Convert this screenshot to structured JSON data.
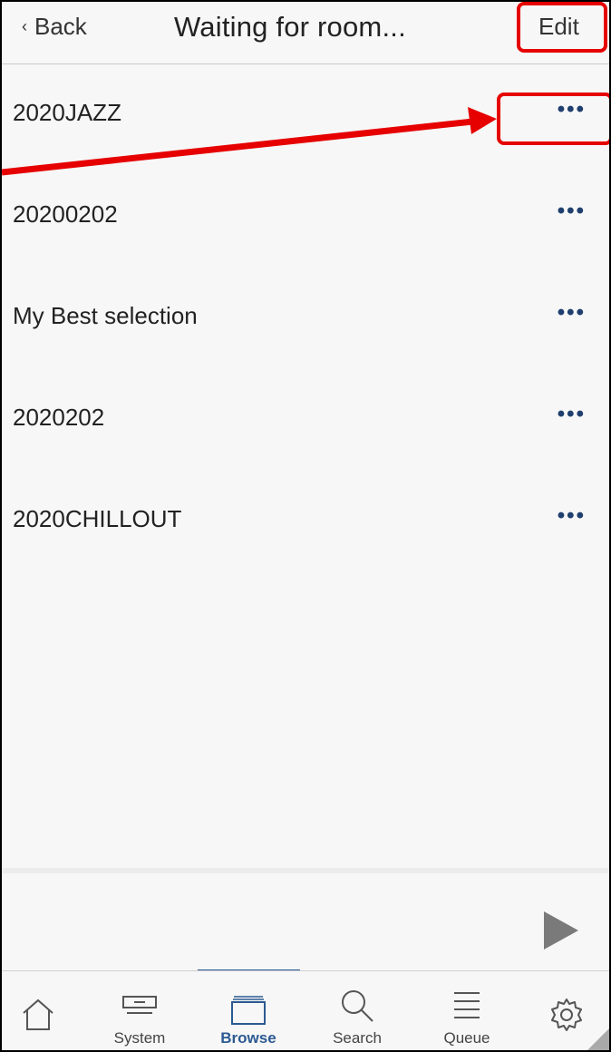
{
  "header": {
    "back_label": "Back",
    "title": "Waiting for room...",
    "edit_label": "Edit"
  },
  "playlists": [
    {
      "name": "2020JAZZ",
      "more": "•••"
    },
    {
      "name": "20200202",
      "more": "•••"
    },
    {
      "name": "My Best selection",
      "more": "•••"
    },
    {
      "name": "2020202",
      "more": "•••"
    },
    {
      "name": "2020CHILLOUT",
      "more": "•••"
    }
  ],
  "tabs": [
    {
      "label": "",
      "icon": "home-icon"
    },
    {
      "label": "System",
      "icon": "system-icon"
    },
    {
      "label": "Browse",
      "icon": "browse-icon",
      "active": true
    },
    {
      "label": "Search",
      "icon": "search-icon"
    },
    {
      "label": "Queue",
      "icon": "queue-icon"
    },
    {
      "label": "",
      "icon": "settings-icon"
    }
  ],
  "colors": {
    "accent": "#2c5a92",
    "annotation": "#e60000",
    "dots": "#1f3f6e"
  }
}
